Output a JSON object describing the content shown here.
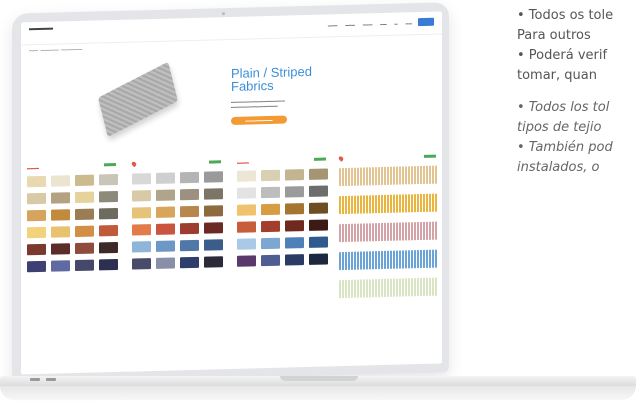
{
  "side_text": [
    {
      "text": "• Todos os tole",
      "style": "normal"
    },
    {
      "text": "  Para outros",
      "style": "normal"
    },
    {
      "text": "• Poderá verif",
      "style": "normal"
    },
    {
      "text": "  tomar, quan",
      "style": "normal"
    },
    {
      "text": "• Todos los tol",
      "style": "italic"
    },
    {
      "text": "  tipos de tejio",
      "style": "italic"
    },
    {
      "text": "• También pod",
      "style": "italic"
    },
    {
      "text": "  instalados, o",
      "style": "italic"
    }
  ],
  "website": {
    "hero_title": "Plain / Striped Fabrics",
    "colors": {
      "accent": "#3b8fd8",
      "cta": "#f29a34",
      "brand": "#e05a4a"
    }
  },
  "swatch_panels": [
    [
      "#e8d9b0",
      "#eae4d0",
      "#cdbb90",
      "#c9c5b8",
      "#d8c9a7",
      "#b3a281",
      "#e6d29b",
      "#8e8a7a",
      "#d5a55d",
      "#c28a3c",
      "#9a7d55",
      "#6d6a5e",
      "#f2d27a",
      "#e8c26e",
      "#d38f45",
      "#c05a3a",
      "#7c3a2f",
      "#5b2c2a",
      "#8f4b3c",
      "#3c2a28",
      "#3e3f73",
      "#5f6aa3",
      "#44486a",
      "#2c2f50"
    ],
    [
      "#d8d8d8",
      "#cfcfcf",
      "#b4b4b4",
      "#9a9a9a",
      "#d8c9a7",
      "#b0a48a",
      "#9d9080",
      "#7d7468",
      "#e7c37a",
      "#d8a65a",
      "#b7874d",
      "#8e6a3f",
      "#e27a4a",
      "#c9553e",
      "#9c3d2f",
      "#6b2a24",
      "#8fb6d8",
      "#6d97c5",
      "#4f78a8",
      "#3c5c8a",
      "#4a4a6a",
      "#8a8fa8",
      "#2d3e6a",
      "#2a2a3a"
    ],
    [
      "#ece6d5",
      "#d9cfb3",
      "#c2b590",
      "#a59572",
      "#e3e3e3",
      "#bdbdbd",
      "#9b9b9b",
      "#6d6d6d",
      "#f0c26d",
      "#d89c44",
      "#a5742e",
      "#6f4d22",
      "#c85d3e",
      "#a23e2b",
      "#6e2a1f",
      "#3c1a15",
      "#a9c9e6",
      "#7ba7d2",
      "#4f80b7",
      "#2f5a8f",
      "#5a3a6a",
      "#4e5e92",
      "#2a3c66",
      "#1c2740"
    ]
  ],
  "stripe_panel": [
    "#e2c493",
    "#e9b43f",
    "#d4a3a8",
    "#6aa3d8",
    "#d8e4c4"
  ]
}
